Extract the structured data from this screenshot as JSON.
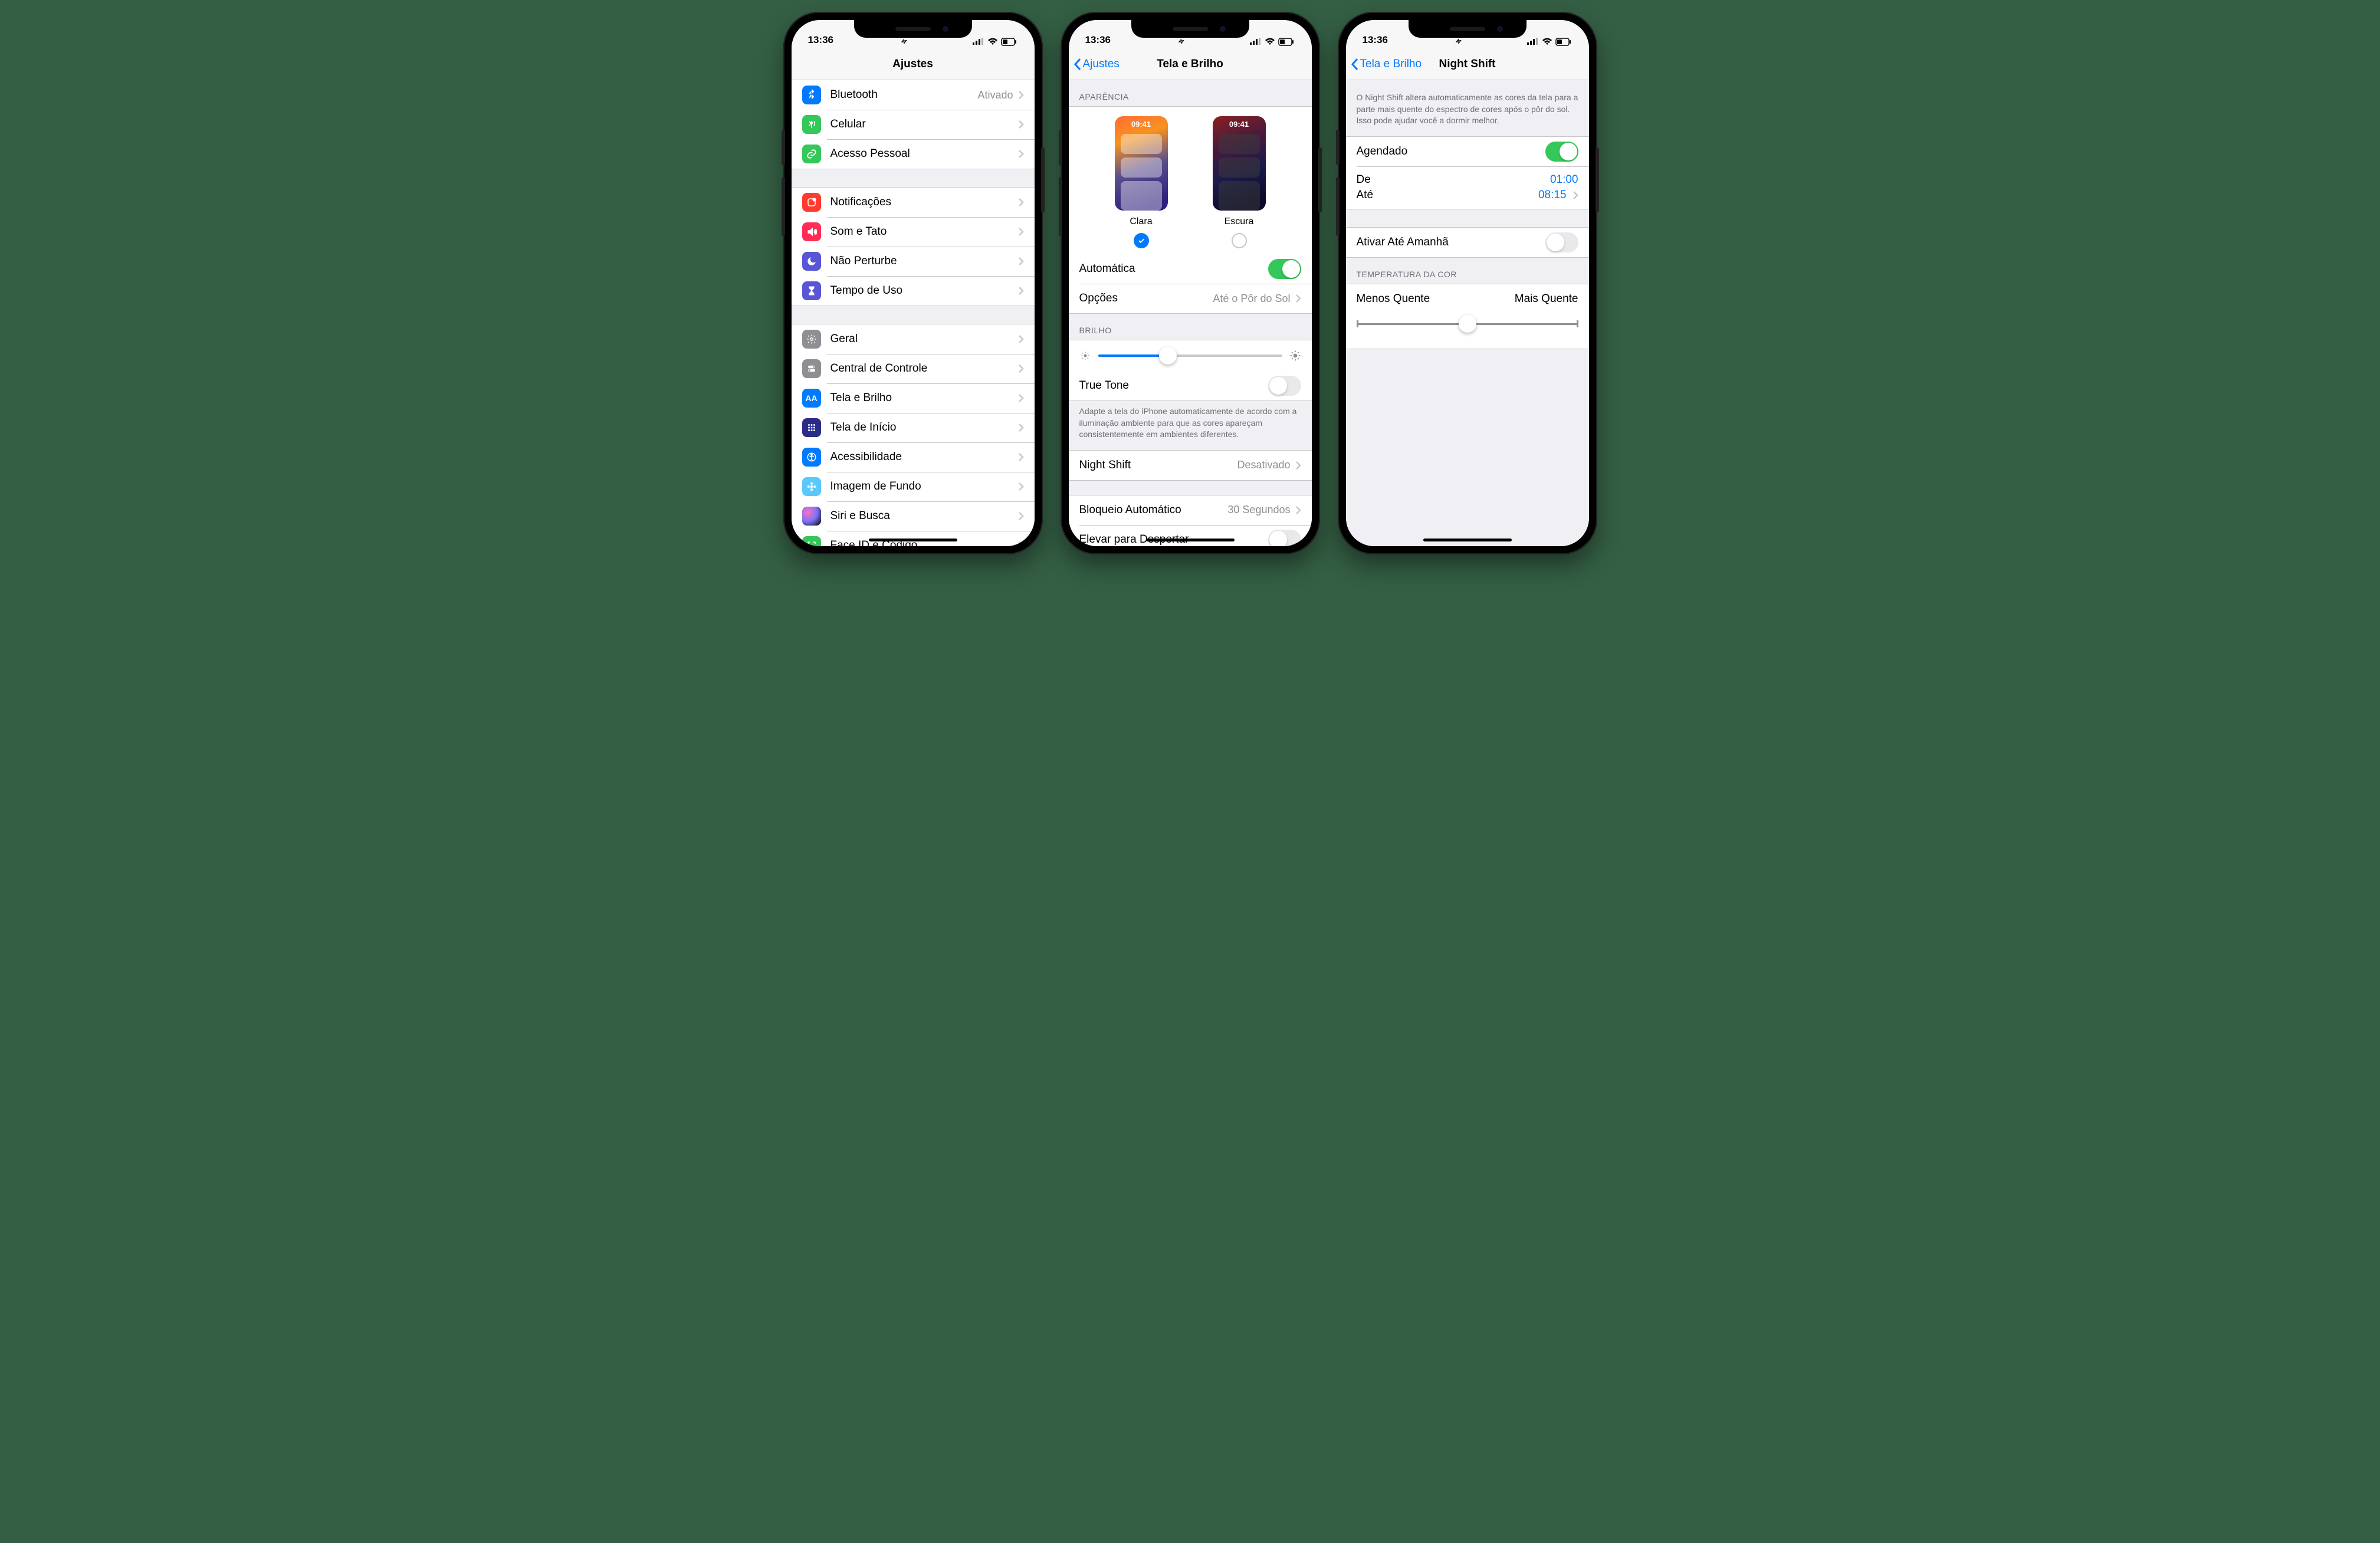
{
  "status": {
    "time": "13:36"
  },
  "screen1": {
    "title": "Ajustes",
    "g1": [
      {
        "icon": "bluetooth",
        "bg": "#007aff",
        "label": "Bluetooth",
        "value": "Ativado"
      },
      {
        "icon": "antenna",
        "bg": "#34c759",
        "label": "Celular",
        "value": ""
      },
      {
        "icon": "link",
        "bg": "#34c759",
        "label": "Acesso Pessoal",
        "value": ""
      }
    ],
    "g2": [
      {
        "icon": "bell",
        "bg": "#ff3b30",
        "label": "Notificações"
      },
      {
        "icon": "speaker",
        "bg": "#ff2d55",
        "label": "Som e Tato"
      },
      {
        "icon": "moon",
        "bg": "#5856d6",
        "label": "Não Perturbe"
      },
      {
        "icon": "hourglass",
        "bg": "#5856d6",
        "label": "Tempo de Uso"
      }
    ],
    "g3": [
      {
        "icon": "gear",
        "bg": "#8e8e93",
        "label": "Geral"
      },
      {
        "icon": "switches",
        "bg": "#8e8e93",
        "label": "Central de Controle"
      },
      {
        "icon": "aa",
        "bg": "#007aff",
        "label": "Tela e Brilho"
      },
      {
        "icon": "grid",
        "bg": "#3a3a7a",
        "label": "Tela de Início"
      },
      {
        "icon": "person",
        "bg": "#007aff",
        "label": "Acessibilidade"
      },
      {
        "icon": "flower",
        "bg": "#5ac8fa",
        "label": "Imagem de Fundo"
      },
      {
        "icon": "siri",
        "bg": "#000",
        "label": "Siri e Busca"
      },
      {
        "icon": "faceid",
        "bg": "#34c759",
        "label": "Face ID e Código"
      }
    ]
  },
  "screen2": {
    "back": "Ajustes",
    "title": "Tela e Brilho",
    "hdr1": "APARÊNCIA",
    "light_label": "Clara",
    "dark_label": "Escura",
    "thumb_time": "09:41",
    "auto": "Automática",
    "options": "Opções",
    "options_val": "Até o Pôr do Sol",
    "hdr2": "BRILHO",
    "truetone": "True Tone",
    "tt_desc": "Adapte a tela do iPhone automaticamente de acordo com a iluminação ambiente para que as cores apareçam consistentemente em ambientes diferentes.",
    "nightshift": "Night Shift",
    "ns_val": "Desativado",
    "autolock": "Bloqueio Automático",
    "al_val": "30 Segundos",
    "raise": "Elevar para Despertar",
    "brightness_pct": 38
  },
  "screen3": {
    "back": "Tela e Brilho",
    "title": "Night Shift",
    "desc": "O Night Shift altera automaticamente as cores da tela para a parte mais quente do espectro de cores após o pôr do sol. Isso pode ajudar você a dormir melhor.",
    "scheduled": "Agendado",
    "from_lbl": "De",
    "from_val": "01:00",
    "to_lbl": "Até",
    "to_val": "08:15",
    "enable": "Ativar Até Amanhã",
    "hdr": "TEMPERATURA DA COR",
    "less": "Menos Quente",
    "more": "Mais Quente",
    "temp_pct": 50
  }
}
